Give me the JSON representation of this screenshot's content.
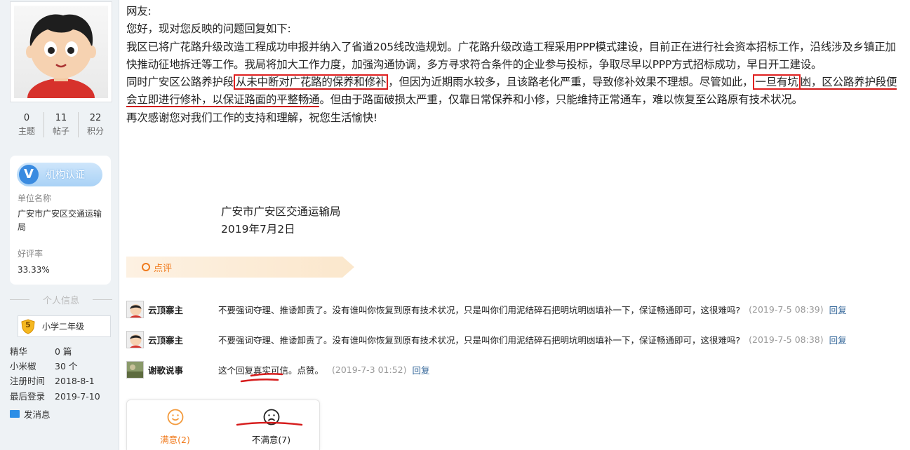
{
  "sidebar": {
    "stats": [
      {
        "num": "0",
        "label": "主题"
      },
      {
        "num": "11",
        "label": "帖子"
      },
      {
        "num": "22",
        "label": "积分"
      }
    ],
    "cert": {
      "badge_label": "机构认证",
      "unit_label": "单位名称",
      "unit_value": "广安市广安区交通运输局",
      "rate_label": "好评率",
      "rate_value": "33.33%"
    },
    "personal_info_title": "个人信息",
    "grade_level": "5",
    "grade_name": "小学二年级",
    "fields": [
      {
        "key": "精华",
        "value": "0 篇"
      },
      {
        "key": "小米椒",
        "value": "30 个"
      },
      {
        "key": "注册时间",
        "value": "2018-8-1"
      },
      {
        "key": "最后登录",
        "value": "2019-7-10"
      }
    ],
    "send_message": "发消息"
  },
  "reply": {
    "greeting": "网友:",
    "intro": "您好，现对您反映的问题回复如下:",
    "para1": "我区已将广花路升级改造工程成功申报并纳入了省道205线改造规划。广花路升级改造工程采用PPP模式建设，目前正在进行社会资本招标工作，沿线涉及乡镇正加快推动征地拆迁等工作。我局将加大工作力度，加强沟通协调，多方寻求符合条件的企业参与投标，争取尽早以PPP方式招标成功，早日开工建设。",
    "para2_a": "同时广安区公路养护段",
    "para2_box1": "从未中断对广花路的保养和修补",
    "para2_b": "，但因为近期雨水较多，且该路老化严重，导致修补效果不理想。尽管如此，",
    "para2_box2": "一旦有坑",
    "para2_c1": "凼",
    "para2_c2": "，区公路养护段便会",
    "para2_c3": "立即进行修补",
    "para2_c4": "，以保证路面的",
    "para2_c5": "平整畅通",
    "para2_d": "。但由于路面破损太严重，仅靠日常保养和小修，只能维持正常通车，难以恢复至公路原有技术状况。",
    "closing": "再次感谢您对我们工作的支持和理解，祝您生活愉快!",
    "signature_org": "广安市广安区交通运输局",
    "signature_date": "2019年7月2日"
  },
  "comments": {
    "tab_label": "点评",
    "items": [
      {
        "user": "云顶寨主",
        "text": "不要强词夺理、推诿卸责了。没有谁叫你恢复到原有技术状况，只是叫你们用泥结碎石把明坑明凼填补一下，保证畅通即可，这很难吗?",
        "time": "(2019-7-5 08:39)",
        "reply": "回复"
      },
      {
        "user": "云顶寨主",
        "text": "不要强词夺理、推诿卸责了。没有谁叫你恢复到原有技术状况，只是叫你们用泥结碎石把明坑明凼填补一下，保证畅通即可，这很难吗?",
        "time": "(2019-7-5 08:38)",
        "reply": "回复"
      },
      {
        "user": "谢歌说事",
        "text": "这个回复真实可信。点赞。",
        "time": "(2019-7-3 01:52)",
        "reply": "回复"
      }
    ]
  },
  "rating": {
    "satisfied": "满意(2)",
    "unsatisfied": "不满意(7)"
  },
  "colors": {
    "accent_orange": "#f07a1c",
    "annotation_red": "#e02020",
    "link_blue": "#336699",
    "sidebar_bg": "#eef2f5"
  }
}
